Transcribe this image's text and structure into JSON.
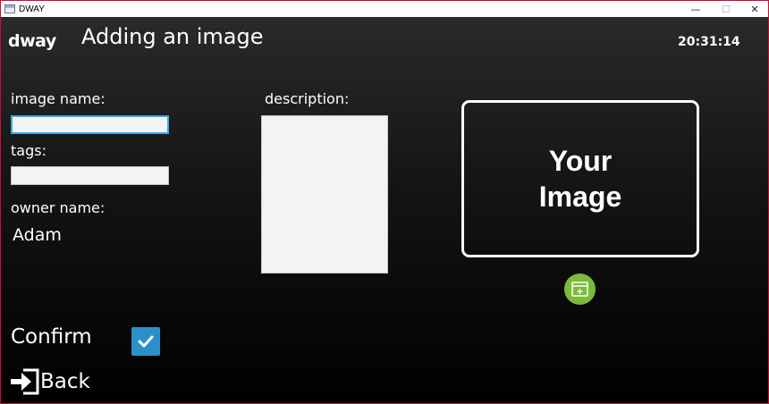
{
  "window": {
    "title": "DWAY",
    "minimize_glyph": "—",
    "maximize_glyph": "☐",
    "close_glyph": "✕"
  },
  "header": {
    "logo": "dway",
    "title": "Adding an image",
    "time": "20:31:14"
  },
  "form": {
    "image_name_label": "image name:",
    "image_name_value": "",
    "tags_label": "tags:",
    "tags_value": "",
    "owner_name_label": "owner name:",
    "owner_name_value": "Adam",
    "description_label": "description:",
    "description_value": ""
  },
  "image_preview": {
    "line1": "Your",
    "line2": "Image",
    "add_icon": "add-image-icon"
  },
  "actions": {
    "confirm_label": "Confirm",
    "confirm_checked": true,
    "back_label": "Back"
  },
  "colors": {
    "accent_blue": "#2b8fc8",
    "add_green": "#7cbb3a",
    "focus_border": "#3aa7e0"
  }
}
